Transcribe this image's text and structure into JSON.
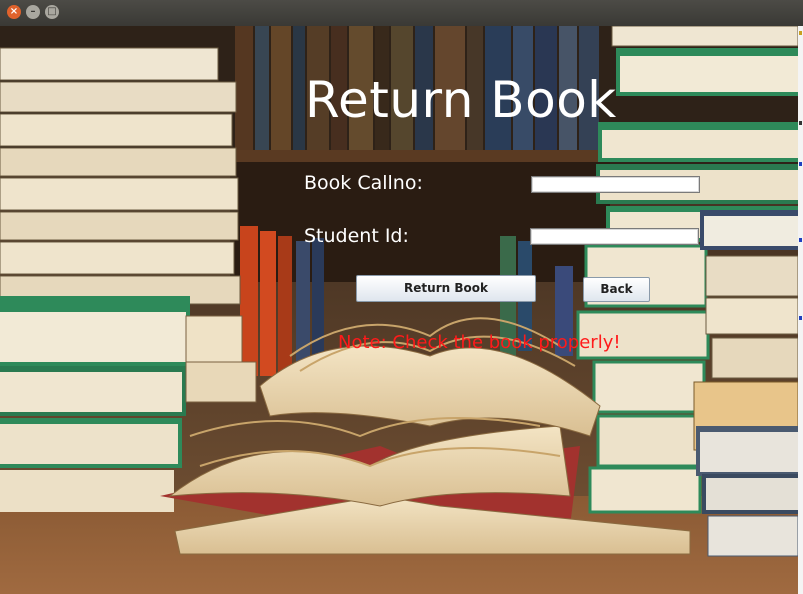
{
  "window": {
    "close_glyph": "×",
    "minimize_glyph": "–",
    "maximize_glyph": "□"
  },
  "form": {
    "title": "Return Book",
    "book_callno_label": "Book Callno:",
    "book_callno_value": "",
    "student_id_label": "Student Id:",
    "student_id_value": "",
    "return_button": "Return Book",
    "back_button": "Back",
    "note": "Note: Check the book properly!"
  },
  "colors": {
    "note": "#ff1a1a",
    "title_text": "#ffffff"
  }
}
